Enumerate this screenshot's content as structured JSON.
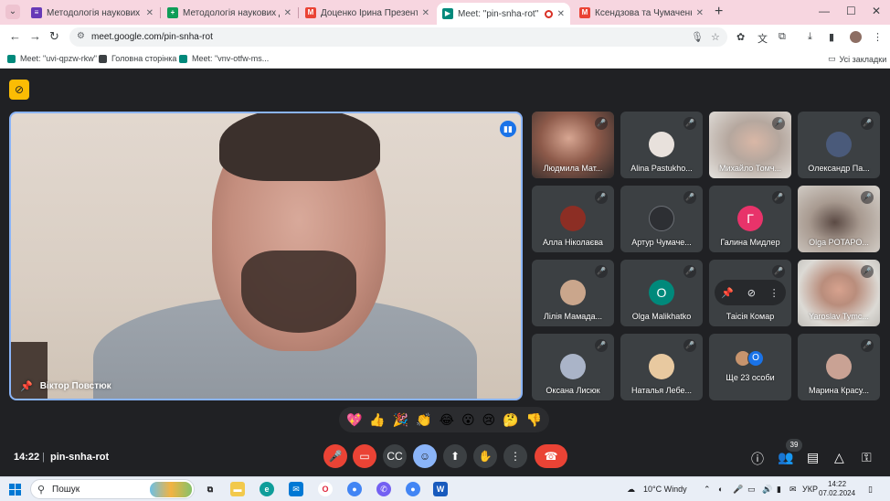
{
  "browser": {
    "tabs": [
      {
        "title": "Методологія наукових дослідж",
        "favicon": "forms-icon",
        "color": "#673ab7"
      },
      {
        "title": "Методологія наукових дослідж",
        "favicon": "sheets-icon",
        "color": "#0f9d58"
      },
      {
        "title": "Доценко Ірина Презентація -",
        "favicon": "gmail-icon",
        "color": "#ea4335"
      },
      {
        "title": "Meet: \"pin-snha-rot\"",
        "favicon": "meet-icon",
        "color": "#00897b",
        "active": true
      },
      {
        "title": "Ксендзова та Чумаченко презе",
        "favicon": "gmail-icon",
        "color": "#ea4335"
      }
    ],
    "new_tab": "+",
    "window_controls": {
      "minimize": "—",
      "maximize": "☐",
      "close": "✕"
    },
    "url": "meet.google.com/pin-snha-rot",
    "bookmarks": [
      {
        "label": "Meet: \"uvi-qpzw-rkw\"",
        "color": "#00897b"
      },
      {
        "label": "Головна сторінка",
        "color": "#3c4043"
      },
      {
        "label": "Meet: \"vnv-otfw-ms...",
        "color": "#00897b"
      }
    ],
    "all_bookmarks": "Усі закладки"
  },
  "meet": {
    "presenter_name": "Віктор Повстюк",
    "participants": [
      {
        "name": "Людмила Мат...",
        "kind": "video",
        "muted": true
      },
      {
        "name": "Alina Pastukho...",
        "kind": "avatar",
        "muted": true,
        "avatar_color": "#e8e1dc"
      },
      {
        "name": "Михайло Томч...",
        "kind": "video",
        "muted": true
      },
      {
        "name": "Олександр Па...",
        "kind": "avatar",
        "muted": true,
        "avatar_color": "#4a5a7a"
      },
      {
        "name": "Алла Ніколаєва",
        "kind": "avatar",
        "muted": true,
        "avatar_color": "#8c2e24"
      },
      {
        "name": "Артур Чумаче...",
        "kind": "avatar",
        "muted": true,
        "avatar_color": "#2d2f33"
      },
      {
        "name": "Галина Мидлер",
        "kind": "letter",
        "letter": "Г",
        "muted": true,
        "avatar_color": "#e8336a"
      },
      {
        "name": "Olga POTAPO...",
        "kind": "video",
        "muted": true
      },
      {
        "name": "Лілія Мамада...",
        "kind": "avatar",
        "muted": true,
        "avatar_color": "#caa68c"
      },
      {
        "name": "Olga Malikhatko",
        "kind": "letter",
        "letter": "O",
        "muted": true,
        "avatar_color": "#00897b"
      },
      {
        "name": "Таісія Комар",
        "kind": "hover",
        "muted": true
      },
      {
        "name": "Yaroslav Tymc...",
        "kind": "video",
        "muted": true
      },
      {
        "name": "Оксана Лисюк",
        "kind": "avatar",
        "muted": true,
        "avatar_color": "#aab4c8"
      },
      {
        "name": "Наталья Лебе...",
        "kind": "avatar",
        "muted": true,
        "avatar_color": "#e8c9a0"
      },
      {
        "name": "Ще 23 особи",
        "kind": "more",
        "letter": "O"
      },
      {
        "name": "Марина Красу...",
        "kind": "avatar",
        "muted": true,
        "avatar_color": "#c9a294"
      }
    ],
    "reactions": [
      "💖",
      "👍",
      "🎉",
      "👏",
      "😂",
      "😮",
      "😢",
      "🤔",
      "👎"
    ],
    "time": "14:22",
    "meeting_code": "pin-snha-rot",
    "participant_count": "39"
  },
  "taskbar": {
    "search_placeholder": "Пошук",
    "weather": "10°C  Windy",
    "language": "УКР",
    "time": "14:22",
    "date": "07.02.2024"
  }
}
